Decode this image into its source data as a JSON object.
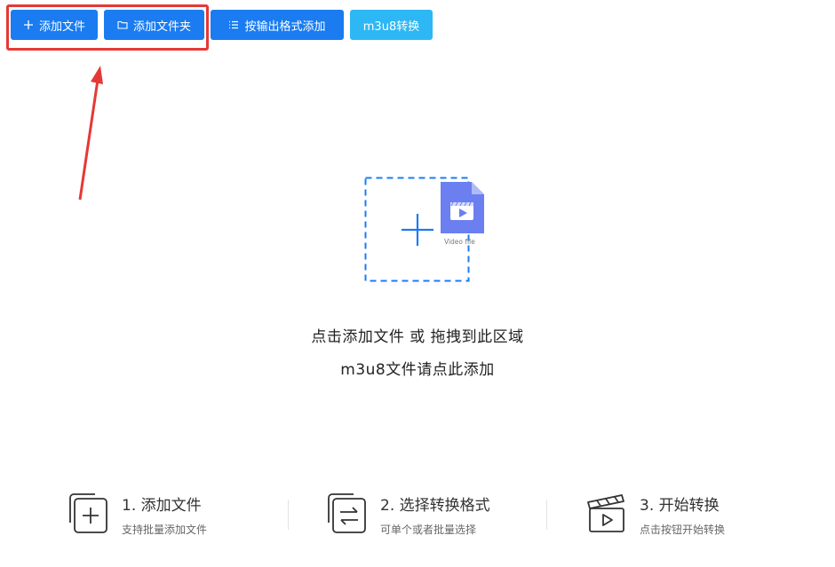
{
  "toolbar": {
    "add_file": "添加文件",
    "add_folder": "添加文件夹",
    "add_by_format": "按输出格式添加",
    "m3u8_convert": "m3u8转换"
  },
  "dropzone": {
    "file_caption": "Video file",
    "hint_primary": "点击添加文件 或 拖拽到此区域",
    "hint_secondary": "m3u8文件请点此添加"
  },
  "steps": [
    {
      "title": "1. 添加文件",
      "desc": "支持批量添加文件",
      "icon": "add-file-icon"
    },
    {
      "title": "2. 选择转换格式",
      "desc": "可单个或者批量选择",
      "icon": "convert-format-icon"
    },
    {
      "title": "3. 开始转换",
      "desc": "点击按钮开始转换",
      "icon": "start-convert-icon"
    }
  ],
  "colors": {
    "primary": "#1a7cf0",
    "light_button": "#2db7f5",
    "highlight": "#e53935",
    "video_icon": "#6b7ff0",
    "dashed_border": "#1a7cf0"
  }
}
